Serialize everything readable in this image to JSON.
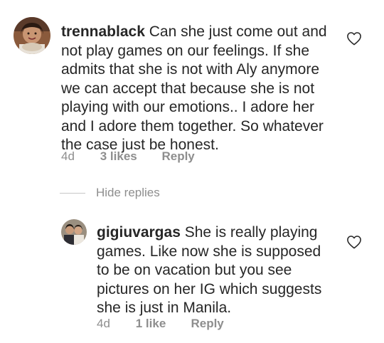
{
  "comments": [
    {
      "username": "trennablack",
      "text": "Can she just come out and not play games on our feelings. If she admits that she is not with Aly anymore we can accept that because she is not playing with our emotions.. I adore her and I adore them together. So whatever the case just be honest.",
      "age": "4d",
      "likes": "3 likes",
      "reply": "Reply"
    },
    {
      "username": "gigiuvargas",
      "text": "She is really playing games. Like now she is supposed to be on vacation but  you see pictures on her IG which suggests she is just in Manila.",
      "age": "4d",
      "likes": "1 like",
      "reply": "Reply"
    }
  ],
  "hide_replies": "Hide replies",
  "icons": {
    "like": "heart-outline-icon"
  },
  "colors": {
    "text": "#262626",
    "secondary": "#8e8e8e",
    "divider": "#c7c7c7"
  }
}
